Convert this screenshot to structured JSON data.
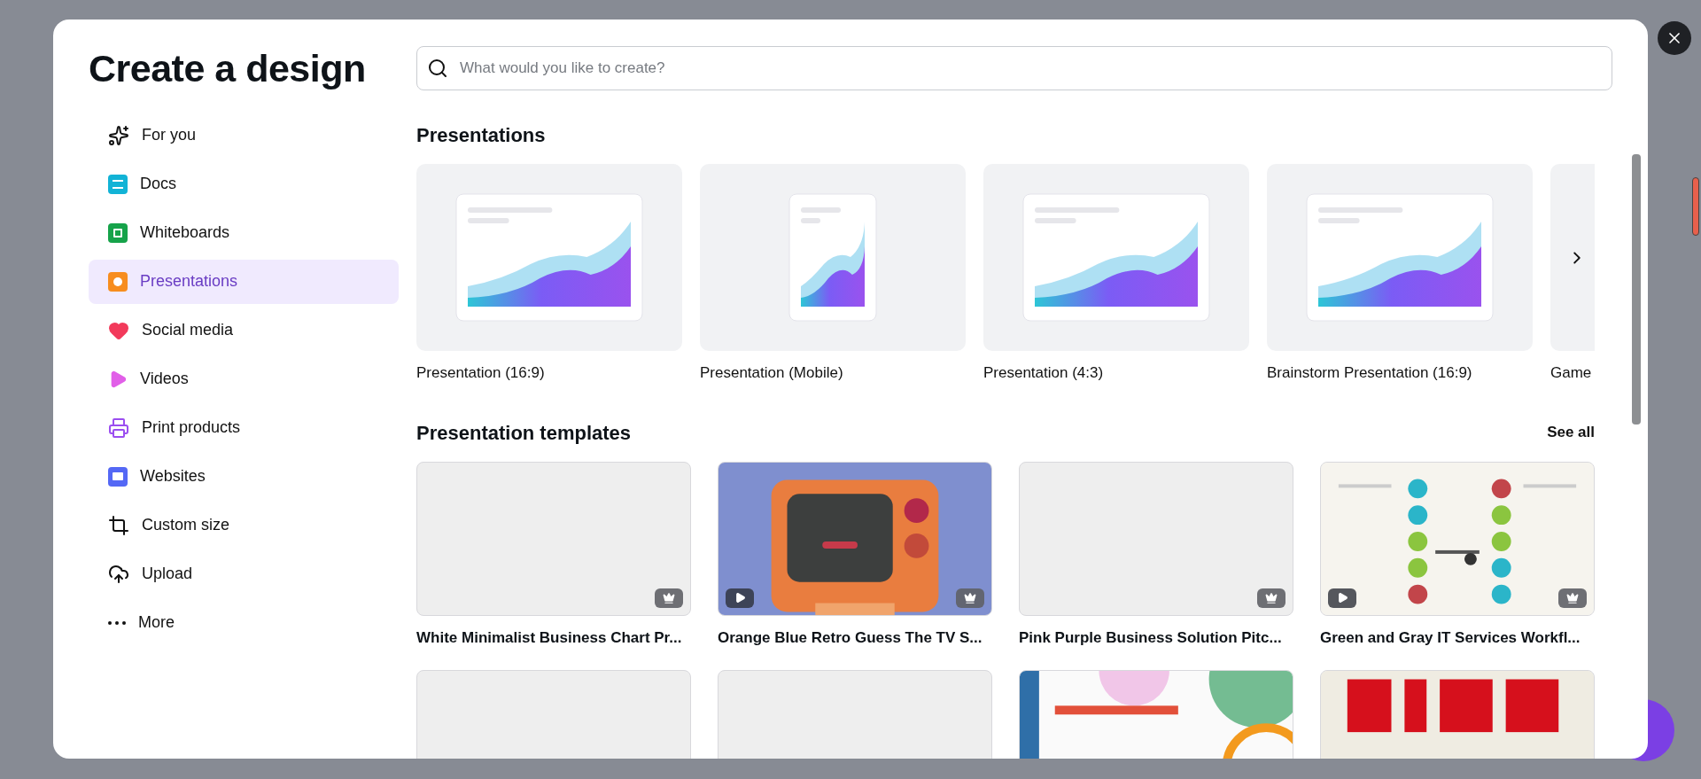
{
  "dialog": {
    "title": "Create a design",
    "search": {
      "placeholder": "What would you like to create?"
    }
  },
  "sidebar": {
    "items": [
      {
        "label": "For you",
        "kind": "sparkles",
        "selected": false
      },
      {
        "label": "Docs",
        "kind": "docs",
        "selected": false
      },
      {
        "label": "Whiteboards",
        "kind": "whiteboards",
        "selected": false
      },
      {
        "label": "Presentations",
        "kind": "presentations",
        "selected": true
      },
      {
        "label": "Social media",
        "kind": "social",
        "selected": false
      },
      {
        "label": "Videos",
        "kind": "videos",
        "selected": false
      },
      {
        "label": "Print products",
        "kind": "print",
        "selected": false
      },
      {
        "label": "Websites",
        "kind": "websites",
        "selected": false
      },
      {
        "label": "Custom size",
        "kind": "custom",
        "selected": false
      },
      {
        "label": "Upload",
        "kind": "upload",
        "selected": false
      },
      {
        "label": "More",
        "kind": "more",
        "selected": false
      }
    ]
  },
  "presentations": {
    "heading": "Presentations",
    "items": [
      {
        "label": "Presentation (16:9)",
        "kind": "wide"
      },
      {
        "label": "Presentation (Mobile)",
        "kind": "mobile"
      },
      {
        "label": "Presentation (4:3)",
        "kind": "wide"
      },
      {
        "label": "Brainstorm Presentation (16:9)",
        "kind": "wide"
      },
      {
        "label": "Game",
        "kind": "cut"
      }
    ]
  },
  "templates": {
    "heading": "Presentation templates",
    "link": "See all",
    "rows": [
      [
        {
          "title": "White Minimalist Business Chart Pr...",
          "kind": "blank",
          "premium": true,
          "video": false
        },
        {
          "title": "Orange Blue Retro Guess The TV S...",
          "kind": "picture",
          "premium": true,
          "video": true
        },
        {
          "title": "Pink Purple Business Solution Pitc...",
          "kind": "blank",
          "premium": true,
          "video": false
        },
        {
          "title": "Green and Gray IT Services Workfl...",
          "kind": "picture",
          "premium": true,
          "video": true
        }
      ],
      [
        {
          "kind": "blank",
          "premium": false,
          "video": false
        },
        {
          "kind": "blank",
          "premium": false,
          "video": false
        },
        {
          "kind": "picture",
          "premium": false,
          "video": false
        },
        {
          "kind": "picture",
          "premium": false,
          "video": false
        }
      ]
    ]
  }
}
